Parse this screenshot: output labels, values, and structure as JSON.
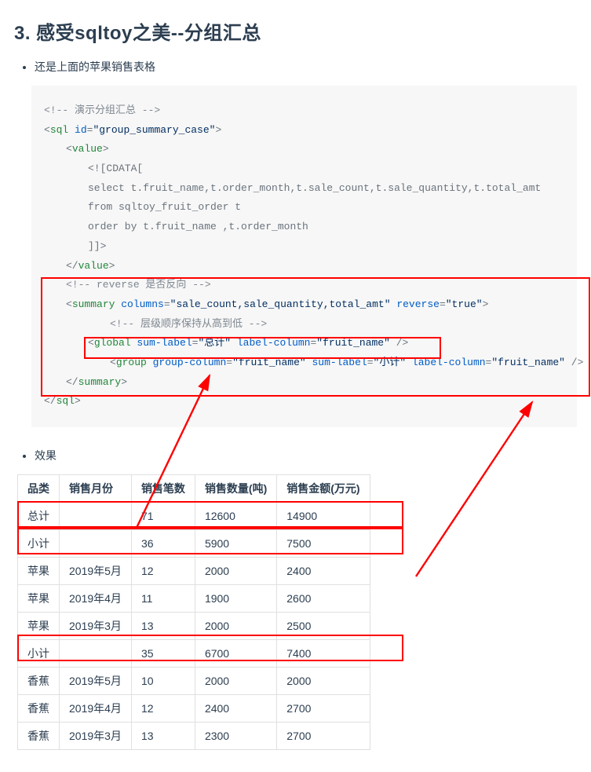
{
  "heading": "3. 感受sqltoy之美--分组汇总",
  "bullet1": "还是上面的苹果销售表格",
  "bullet2": "效果",
  "code": {
    "c01": "<!-- 演示分组汇总 -->",
    "c02a": "<",
    "c02b": "sql",
    "c02c": " id",
    "c02d": "=",
    "c02e": "\"group_summary_case\"",
    "c02f": ">",
    "c03a": "<",
    "c03b": "value",
    "c03c": ">",
    "c04": "<![CDATA[",
    "c05": "select t.fruit_name,t.order_month,t.sale_count,t.sale_quantity,t.total_amt",
    "c06": "from sqltoy_fruit_order t",
    "c07": "order by t.fruit_name ,t.order_month",
    "c08": "]]>",
    "c09a": "</",
    "c09b": "value",
    "c09c": ">",
    "c10": "<!-- reverse 是否反向 -->",
    "c11a": "<",
    "c11b": "summary",
    "c11c": " columns",
    "c11d": "=",
    "c11e": "\"sale_count,sale_quantity,total_amt\"",
    "c11f": " reverse",
    "c11g": "=",
    "c11h": "\"true\"",
    "c11i": ">",
    "c12": "<!-- 层级顺序保持从高到低 -->",
    "c13a": "<",
    "c13b": "global",
    "c13c": " sum-label",
    "c13d": "=",
    "c13e": "\"总计\"",
    "c13f": " label-column",
    "c13g": "=",
    "c13h": "\"fruit_name\"",
    "c13i": " />",
    "c14a": "<",
    "c14b": "group",
    "c14c": " group-column",
    "c14d": "=",
    "c14e": "\"fruit_name\"",
    "c14f": " sum-label",
    "c14g": "=",
    "c14h": "\"小计\"",
    "c14i": " label-column",
    "c14j": "=",
    "c14k": "\"fruit_name\"",
    "c14l": " />",
    "c15a": "</",
    "c15b": "summary",
    "c15c": ">",
    "c16a": "</",
    "c16b": "sql",
    "c16c": ">"
  },
  "table": {
    "headers": [
      "品类",
      "销售月份",
      "销售笔数",
      "销售数量(吨)",
      "销售金额(万元)"
    ],
    "rows": [
      [
        "总计",
        "",
        "71",
        "12600",
        "14900"
      ],
      [
        "小计",
        "",
        "36",
        "5900",
        "7500"
      ],
      [
        "苹果",
        "2019年5月",
        "12",
        "2000",
        "2400"
      ],
      [
        "苹果",
        "2019年4月",
        "11",
        "1900",
        "2600"
      ],
      [
        "苹果",
        "2019年3月",
        "13",
        "2000",
        "2500"
      ],
      [
        "小计",
        "",
        "35",
        "6700",
        "7400"
      ],
      [
        "香蕉",
        "2019年5月",
        "10",
        "2000",
        "2000"
      ],
      [
        "香蕉",
        "2019年4月",
        "12",
        "2400",
        "2700"
      ],
      [
        "香蕉",
        "2019年3月",
        "13",
        "2300",
        "2700"
      ]
    ]
  }
}
